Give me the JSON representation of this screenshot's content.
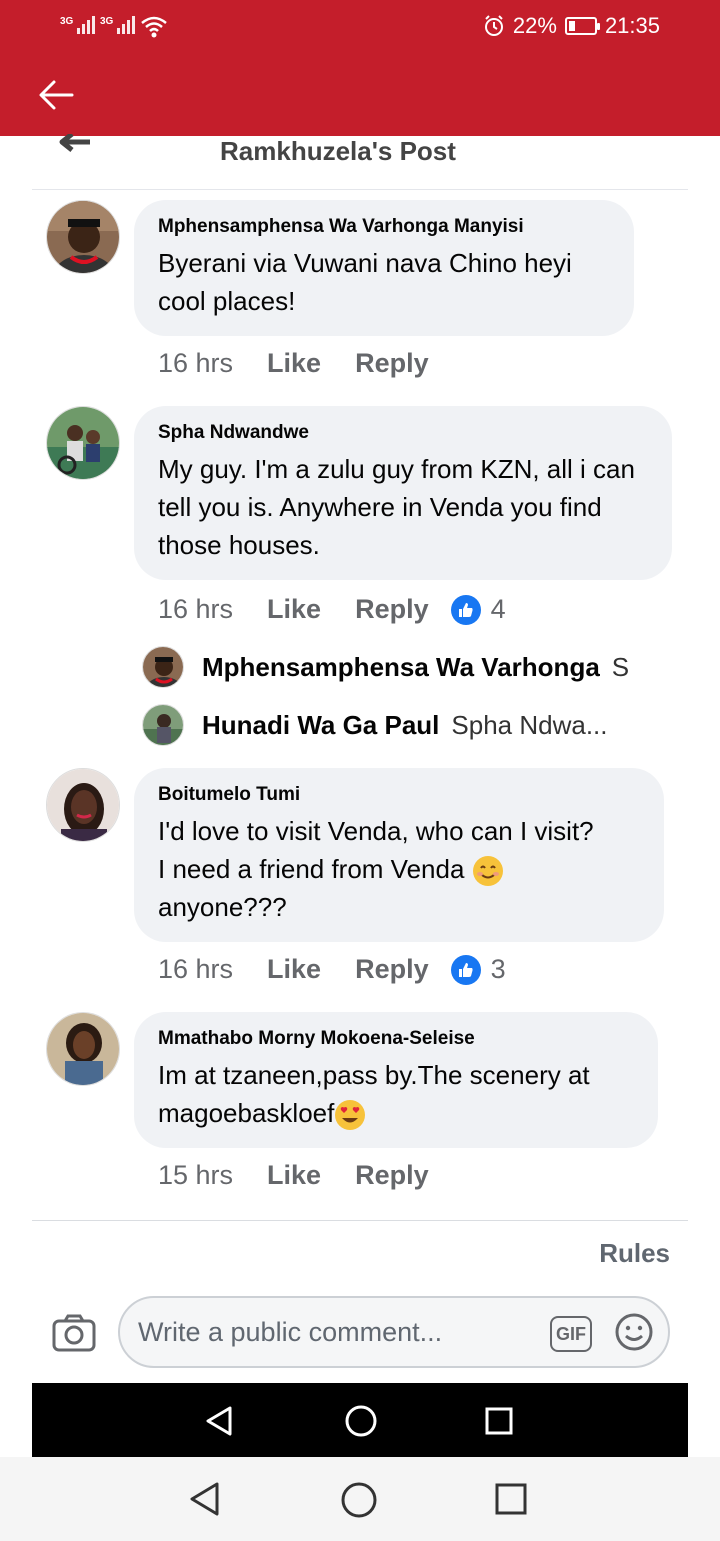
{
  "status_bar": {
    "network1": "3G",
    "network2": "3G",
    "alarm_icon": "alarm-icon",
    "battery": "22%",
    "time": "21:35"
  },
  "header": {
    "back_icon": "arrow-left-icon",
    "post_title": "Ramkhuzela's Post"
  },
  "comments": [
    {
      "author": "Mphensamphensa Wa Varhonga Manyisi",
      "text": "Byerani via Vuwani nava Chino heyi cool places!",
      "time": "16 hrs",
      "like_label": "Like",
      "reply_label": "Reply"
    },
    {
      "author": "Spha Ndwandwe",
      "text": "My guy. I'm a zulu guy from KZN, all i can tell you is. Anywhere in Venda you find those houses.",
      "time": "16 hrs",
      "like_label": "Like",
      "reply_label": "Reply",
      "reactions": "4",
      "replies": [
        {
          "author": "Mphensamphensa Wa Varhonga",
          "text": "S"
        },
        {
          "author": "Hunadi Wa Ga Paul",
          "text": "Spha Ndwa..."
        }
      ]
    },
    {
      "author": "Boitumelo Tumi",
      "text_line1": "I'd love to visit Venda, who can I visit?",
      "text_line2": "I need a friend from Venda",
      "text_line3": "anyone???",
      "emoji": "smiling-face-emoji",
      "time": "16 hrs",
      "like_label": "Like",
      "reply_label": "Reply",
      "reactions": "3"
    },
    {
      "author": "Mmathabo Morny Mokoena-Seleise",
      "text_line1": "Im at tzaneen,pass by.The scenery at",
      "text_line2": "magoebaskloef",
      "emoji": "heart-eyes-emoji",
      "time": "15 hrs",
      "like_label": "Like",
      "reply_label": "Reply"
    }
  ],
  "footer": {
    "rules_label": "Rules",
    "composer_placeholder": "Write a public comment...",
    "gif_label": "GIF",
    "camera_icon": "camera-icon",
    "emoji_icon": "smiley-icon"
  },
  "colors": {
    "header_red": "#c41e2b",
    "bubble_bg": "#f0f2f5",
    "like_blue": "#1877f2"
  }
}
